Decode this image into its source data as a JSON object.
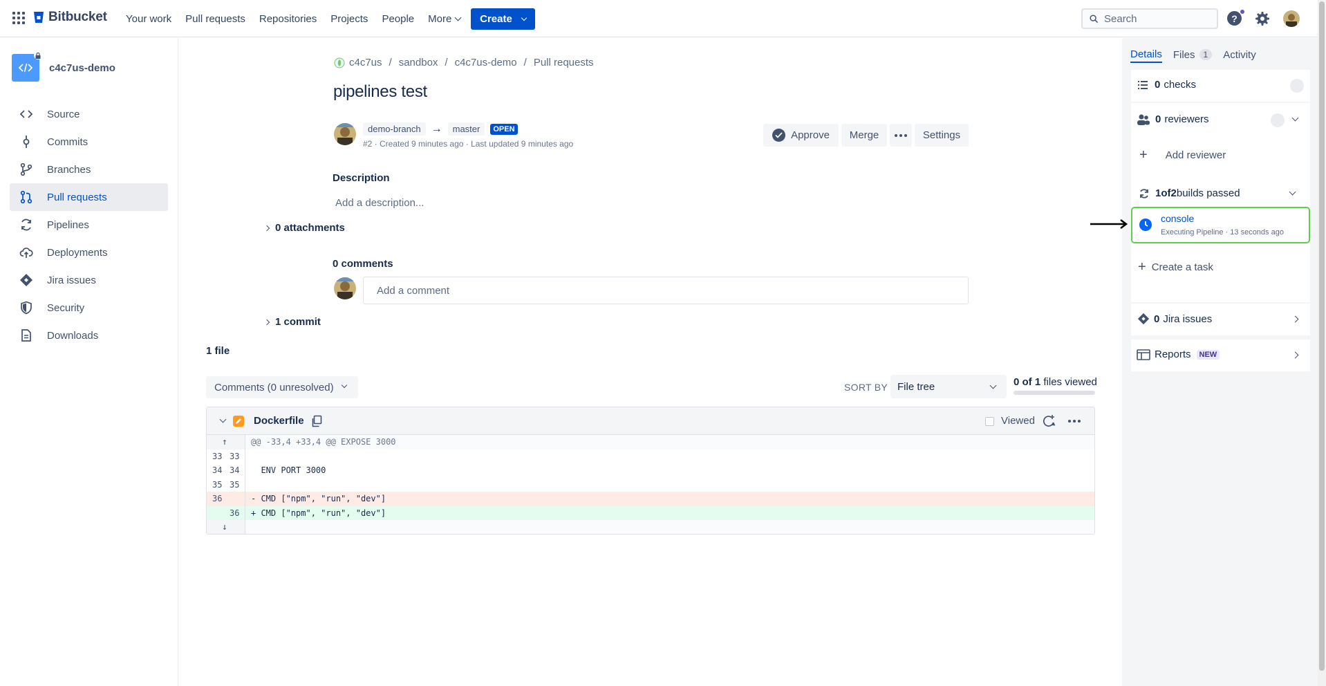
{
  "topnav": {
    "brand": "Bitbucket",
    "links": [
      "Your work",
      "Pull requests",
      "Repositories",
      "Projects",
      "People"
    ],
    "more_label": "More",
    "create_label": "Create",
    "search_placeholder": "Search",
    "help_glyph": "?"
  },
  "sidebar": {
    "repo_name": "c4c7us-demo",
    "items": [
      {
        "label": "Source",
        "icon": "code-icon"
      },
      {
        "label": "Commits",
        "icon": "commit-icon"
      },
      {
        "label": "Branches",
        "icon": "branch-icon"
      },
      {
        "label": "Pull requests",
        "icon": "pull-request-icon",
        "active": true
      },
      {
        "label": "Pipelines",
        "icon": "pipelines-icon"
      },
      {
        "label": "Deployments",
        "icon": "cloud-upload-icon"
      },
      {
        "label": "Jira issues",
        "icon": "jira-icon"
      },
      {
        "label": "Security",
        "icon": "shield-icon"
      },
      {
        "label": "Downloads",
        "icon": "document-icon"
      }
    ]
  },
  "breadcrumb": [
    "c4c7us",
    "sandbox",
    "c4c7us-demo",
    "Pull requests"
  ],
  "pr": {
    "title": "pipelines test",
    "source_branch": "demo-branch",
    "target_branch": "master",
    "state": "OPEN",
    "meta": "#2 · Created 9 minutes ago · Last updated 9 minutes ago",
    "actions": {
      "approve": "Approve",
      "merge": "Merge",
      "more": "•••",
      "settings": "Settings"
    },
    "description_label": "Description",
    "description_placeholder": "Add a description...",
    "attachments_label": "0 attachments",
    "comments_label": "0 comments",
    "comment_placeholder": "Add a comment",
    "commits_label": "1 commit"
  },
  "files": {
    "count_label": "1 file",
    "comments_filter": "Comments (0 unresolved)",
    "sort_by_label": "SORT BY",
    "sort_value": "File tree",
    "viewed_bold": "0 of 1",
    "viewed_rest": " files viewed",
    "viewed_fraction": 0
  },
  "diff": {
    "file_name": "Dockerfile",
    "viewed_label": "Viewed",
    "hunk_header": "@@ -33,4 +33,4 @@ EXPOSE 3000",
    "lines": [
      {
        "old": "33",
        "new": "33",
        "text": "",
        "type": "ctx"
      },
      {
        "old": "34",
        "new": "34",
        "text": "  ENV PORT 3000",
        "type": "ctx"
      },
      {
        "old": "35",
        "new": "35",
        "text": "",
        "type": "ctx"
      },
      {
        "old": "36",
        "new": "",
        "text": "- CMD [\"npm\", \"run\", \"dev\"]",
        "type": "del"
      },
      {
        "old": "",
        "new": "36",
        "text": "+ CMD [\"npm\", \"run\", \"dev\"]",
        "type": "add"
      }
    ]
  },
  "rpanel": {
    "tabs": {
      "details": "Details",
      "files": "Files",
      "files_count": "1",
      "activity": "Activity"
    },
    "checks_count": "0",
    "checks_label": "checks",
    "reviewers_count": "0",
    "reviewers_label": "reviewers",
    "add_reviewer": "Add reviewer",
    "builds_a": "1",
    "builds_of": " of ",
    "builds_b": "2",
    "builds_rest": " builds passed",
    "build_name": "console",
    "build_status": "Executing Pipeline  ·  13 seconds ago",
    "create_task": "Create a task",
    "jira_count": "0",
    "jira_label": "Jira issues",
    "reports_label": "Reports",
    "reports_badge": "NEW"
  },
  "colors": {
    "primary": "#0052cc",
    "build_border": "#5bd04a",
    "del_bg": "#ffebe6",
    "add_bg": "#e3fcef"
  }
}
